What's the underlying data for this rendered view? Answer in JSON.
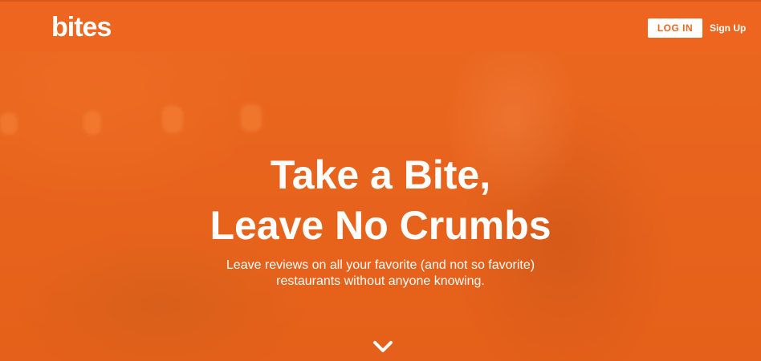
{
  "header": {
    "logo_text": "bites",
    "login_label": "LOG IN",
    "signup_label": "Sign Up"
  },
  "hero": {
    "title_line1": "Take a Bite,",
    "title_line2": "Leave No Crumbs",
    "subtitle_line1": "Leave reviews on all your favorite (and not so favorite)",
    "subtitle_line2": "restaurants without anyone knowing.",
    "scroll_icon": "chevron-down-icon"
  },
  "colors": {
    "brand_orange": "#ee6520",
    "text_white": "#ffffff"
  }
}
